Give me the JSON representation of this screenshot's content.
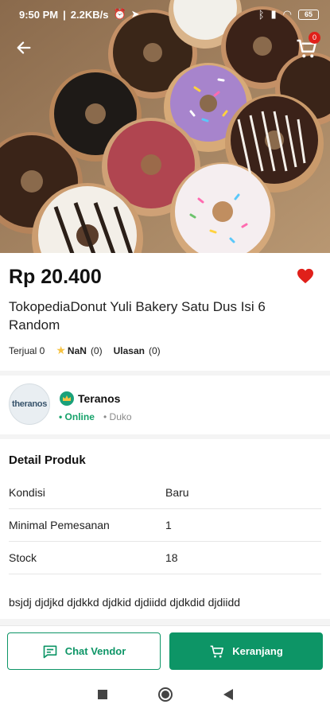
{
  "status_bar": {
    "time": "9:50 PM",
    "speed": "2.2KB/s",
    "battery": "65"
  },
  "header": {
    "cart_count": "0"
  },
  "product": {
    "price": "Rp 20.400",
    "title": "TokopediaDonut Yuli Bakery Satu Dus Isi 6 Random",
    "sold_label": "Terjual 0",
    "rating": "NaN",
    "rating_count": "(0)",
    "reviews_label": "Ulasan",
    "reviews_count": "(0)"
  },
  "vendor": {
    "logo_text": "theranos",
    "name": "Teranos",
    "status": "• Online",
    "city": "• Duko"
  },
  "detail": {
    "heading": "Detail Produk",
    "rows": [
      {
        "key": "Kondisi",
        "value": "Baru"
      },
      {
        "key": "Minimal Pemesanan",
        "value": "1"
      },
      {
        "key": "Stock",
        "value": "18"
      }
    ],
    "description": "bsjdj djdjkd djdkkd djdkid djdiidd djdkdid djdiidd"
  },
  "actions": {
    "chat_label": "Chat Vendor",
    "cart_label": "Keranjang"
  },
  "colors": {
    "primary": "#0d9566",
    "heart": "#e0201a",
    "online": "#16a26a"
  }
}
